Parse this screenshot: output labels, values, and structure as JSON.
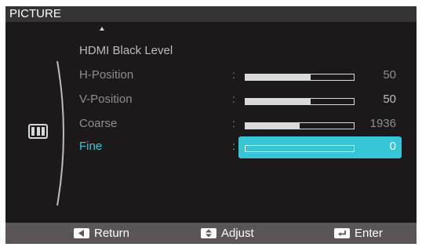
{
  "menu": {
    "title": "PICTURE",
    "category_icon": "picture-category-icon",
    "items": [
      {
        "label": "HDMI Black Level",
        "value": null,
        "level": null,
        "selected": false
      },
      {
        "label": "H-Position",
        "value": "50",
        "level": 0.6,
        "selected": false
      },
      {
        "label": "V-Position",
        "value": "50",
        "level": 0.6,
        "selected": false
      },
      {
        "label": "Coarse",
        "value": "1936",
        "level": 0.5,
        "selected": false
      },
      {
        "label": "Fine",
        "value": "0",
        "level": 0,
        "selected": true
      }
    ]
  },
  "footer": {
    "return_label": "Return",
    "return_icon": "left-arrow-key-icon",
    "adjust_label": "Adjust",
    "adjust_icon": "up-down-key-icon",
    "enter_label": "Enter",
    "enter_icon": "enter-key-icon"
  },
  "colors": {
    "highlight": "#37c6d8",
    "background": "#1b1919",
    "title_bar": "#353334",
    "footer_bar": "#5a5556"
  }
}
